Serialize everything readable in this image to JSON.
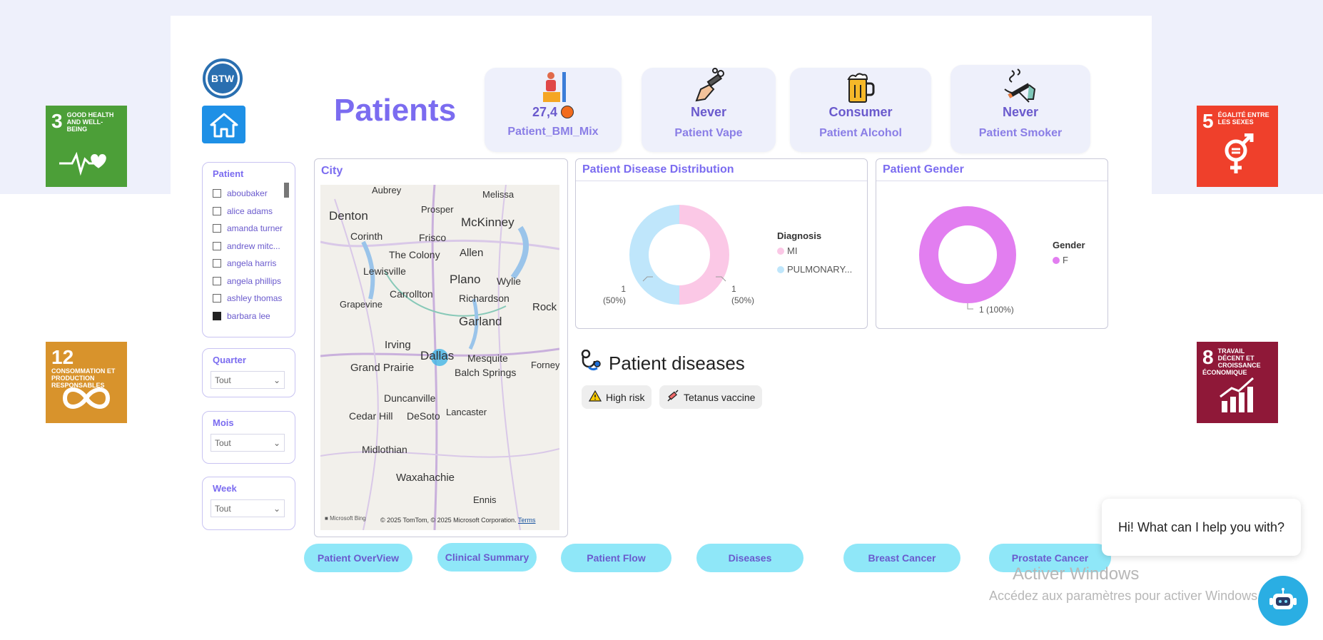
{
  "page": {
    "title": "Patients"
  },
  "sdg_tiles": [
    {
      "num": "3",
      "text": "GOOD HEALTH AND WELL-BEING",
      "color": "#4c9f38"
    },
    {
      "num": "12",
      "text": "CONSOMMATION ET PRODUCTION RESPONSABLES",
      "color": "#d8932c"
    },
    {
      "num": "5",
      "text": "ÉGALITÉ ENTRE LES SEXES",
      "color": "#ef402b"
    },
    {
      "num": "8",
      "text": "TRAVAIL DÉCENT ET CROISSANCE ÉCONOMIQUE",
      "color": "#8f1838"
    }
  ],
  "logo": {
    "text": "BTW"
  },
  "kpis": [
    {
      "value": "27,4",
      "label": "Patient_BMI_Mix",
      "icon": "bmi-person-icon"
    },
    {
      "value": "Never",
      "label": "Patient Vape",
      "icon": "vape-icon"
    },
    {
      "value": "Consumer",
      "label": "Patient Alcohol",
      "icon": "beer-mug-icon"
    },
    {
      "value": "Never",
      "label": "Patient Smoker",
      "icon": "cigarette-icon"
    }
  ],
  "patient_slicer": {
    "title": "Patient",
    "options": [
      {
        "label": "aboubaker",
        "checked": false
      },
      {
        "label": "alice adams",
        "checked": false
      },
      {
        "label": "amanda turner",
        "checked": false
      },
      {
        "label": "andrew mitc...",
        "checked": false
      },
      {
        "label": "angela harris",
        "checked": false
      },
      {
        "label": "angela phillips",
        "checked": false
      },
      {
        "label": "ashley thomas",
        "checked": false
      },
      {
        "label": "barbara lee",
        "checked": true
      }
    ]
  },
  "quarter_slicer": {
    "title": "Quarter",
    "value": "Tout"
  },
  "mois_slicer": {
    "title": "Mois",
    "value": "Tout"
  },
  "week_slicer": {
    "title": "Week",
    "value": "Tout"
  },
  "city_map": {
    "title": "City",
    "labels": [
      "Aubrey",
      "Melissa",
      "Prosper",
      "Denton",
      "McKinney",
      "Corinth",
      "Frisco",
      "The Colony",
      "Allen",
      "Lewisville",
      "Plano",
      "Wylie",
      "Carrollton",
      "Richardson",
      "Grapevine",
      "Rock",
      "Garland",
      "Irving",
      "Dallas",
      "Mesquite",
      "Forney",
      "Grand Prairie",
      "Balch Springs",
      "Duncanville",
      "Lancaster",
      "Cedar Hill",
      "DeSoto",
      "Midlothian",
      "Waxahachie",
      "Ennis"
    ],
    "attribution": "© 2025 TomTom, © 2025 Microsoft Corporation",
    "terms": "Terms",
    "brand": "Microsoft Bing"
  },
  "disease_chart": {
    "title": "Patient Disease Distribution",
    "legend_title": "Diagnosis",
    "chart_data": {
      "type": "pie",
      "series": [
        {
          "name": "MI",
          "value": 1,
          "label": "1",
          "pct": "(50%)",
          "color": "#fbc8e6"
        },
        {
          "name": "PULMONARY...",
          "value": 1,
          "label": "1",
          "pct": "(50%)",
          "color": "#bfe6fb"
        }
      ]
    }
  },
  "gender_chart": {
    "title": "Patient Gender",
    "legend_title": "Gender",
    "chart_data": {
      "type": "pie",
      "series": [
        {
          "name": "F",
          "value": 1,
          "label": "1 (100%)",
          "color": "#e27ef0"
        }
      ]
    }
  },
  "patient_diseases": {
    "title": "Patient diseases",
    "chips": [
      {
        "label": "High risk",
        "icon": "warning-icon"
      },
      {
        "label": "Tetanus vaccine",
        "icon": "syringe-icon"
      }
    ]
  },
  "nav_buttons": [
    {
      "label": "Patient OverView"
    },
    {
      "label": "Clinical Summary"
    },
    {
      "label": "Patient Flow"
    },
    {
      "label": "Diseases"
    },
    {
      "label": "Breast Cancer"
    },
    {
      "label": "Prostate Cancer"
    }
  ],
  "chat": {
    "greeting": "Hi! What can I help you with?"
  },
  "watermark": {
    "line1": "Activer Windows",
    "line2": "Accédez aux paramètres pour activer Windows."
  }
}
